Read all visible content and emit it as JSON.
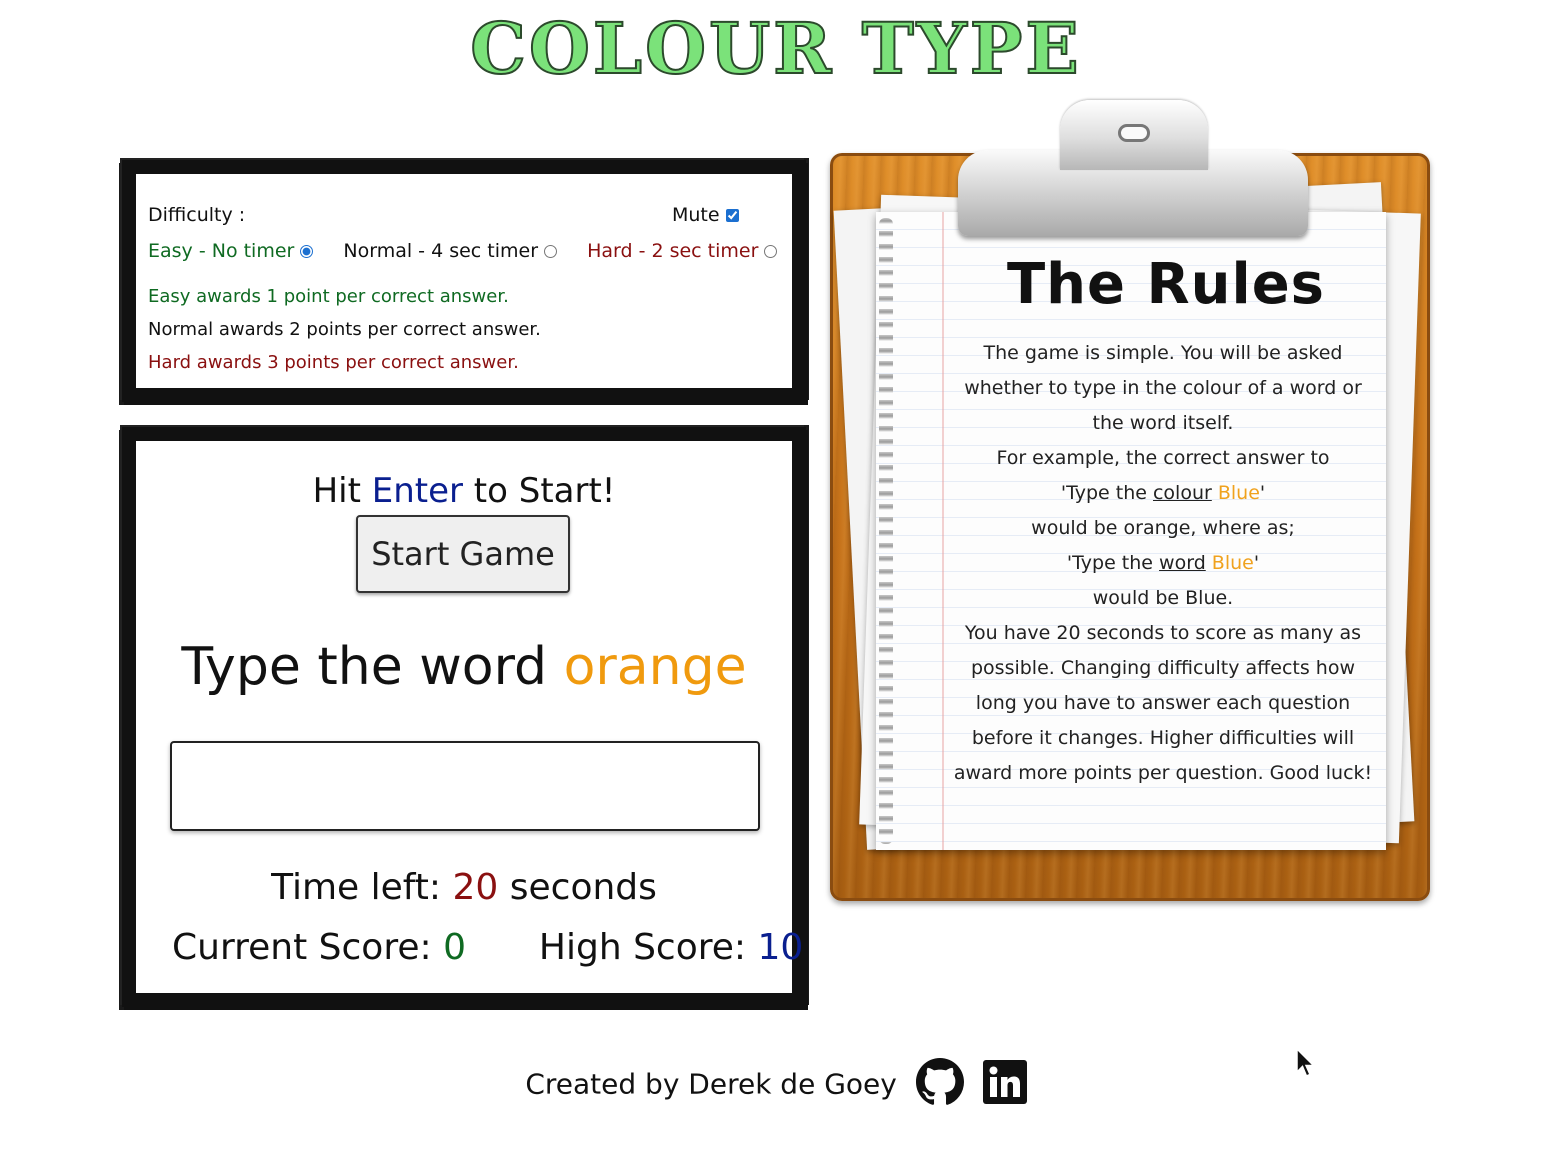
{
  "app_title": "COLOUR TYPE",
  "settings": {
    "difficulty_label": "Difficulty :",
    "mute_label": "Mute",
    "mute_checked": true,
    "options": [
      {
        "label": "Easy - No timer",
        "selected": true
      },
      {
        "label": "Normal - 4 sec timer",
        "selected": false
      },
      {
        "label": "Hard - 2 sec timer",
        "selected": false
      }
    ],
    "awards": [
      "Easy awards 1 point per correct answer.",
      "Normal awards 2 points per correct answer.",
      "Hard awards 3 points per correct answer."
    ]
  },
  "game": {
    "hit_prefix": "Hit",
    "hit_key": "Enter",
    "hit_suffix": "to Start!",
    "start_button": "Start Game",
    "prompt_prefix": "Type the word",
    "prompt_word": "orange",
    "answer_value": "",
    "time_label": "Time left:",
    "time_value": "20",
    "time_unit": "seconds",
    "current_score_label": "Current Score:",
    "current_score": "0",
    "high_score_label": "High Score:",
    "high_score": "10"
  },
  "rules": {
    "title": "The Rules",
    "p1": "The game is simple. You will be asked whether to type in the colour of a word or the word itself.",
    "p2": "For example, the correct answer to",
    "ex1_prefix": "'Type the",
    "ex1_keyword": "colour",
    "ex1_word": "Blue",
    "ex1_close": "'",
    "ex1_result": "would be orange, where as;",
    "ex2_prefix": "'Type the",
    "ex2_keyword": "word",
    "ex2_word": "Blue",
    "ex2_close": "'",
    "ex2_result": "would be Blue.",
    "p3": "You have 20 seconds to score as many as possible. Changing difficulty affects how long you have to answer each question before it changes. Higher difficulties will award more points per question. Good luck!"
  },
  "footer": {
    "credit": "Created by Derek de Goey",
    "icons": [
      "github-icon",
      "linkedin-icon"
    ]
  },
  "colors": {
    "title": "#7be27a",
    "easy": "#0f6a22",
    "hard": "#8a1010",
    "enter": "#0a1f8f",
    "prompt_word": "#f09a0e"
  }
}
